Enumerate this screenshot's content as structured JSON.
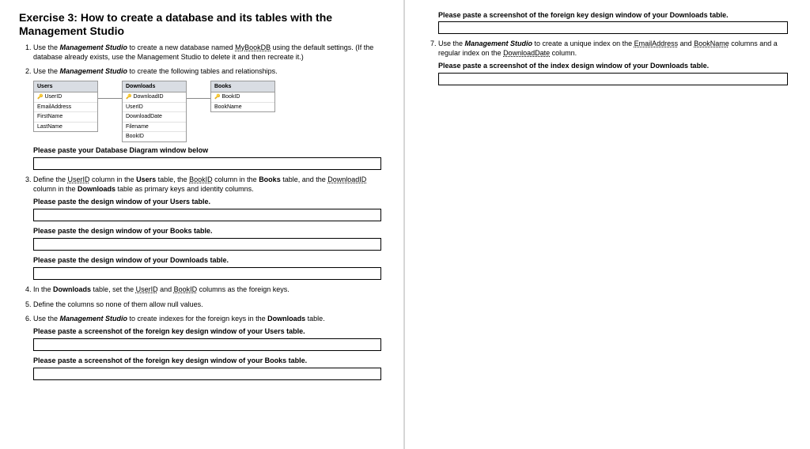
{
  "title": "Exercise 3: How to create a database and its tables with the Management Studio",
  "left": {
    "step1": {
      "pre": "Use the ",
      "tool": "Management Studio",
      "mid": " to create a new database named ",
      "db": "MyBookDB",
      "post": " using the default settings. (If the database already exists, use the Management Studio to delete it and then recreate it.)"
    },
    "step2": {
      "pre": "Use the ",
      "tool": "Management Studio",
      "post": " to create the following tables and relationships."
    },
    "diagram": {
      "users": {
        "title": "Users",
        "rows": [
          "UserID",
          "EmailAddress",
          "FirstName",
          "LastName"
        ]
      },
      "downloads": {
        "title": "Downloads",
        "rows": [
          "DownloadID",
          "UserID",
          "DownloadDate",
          "Filename",
          "BookID"
        ]
      },
      "books": {
        "title": "Books",
        "rows": [
          "BookID",
          "BookName"
        ]
      }
    },
    "diagPrompt": "Please paste your Database Diagram window below",
    "step3": {
      "p1": "Define the ",
      "c1": "UserID",
      "p2": " column in the ",
      "t1": "Users",
      "p3": " table, the ",
      "c2": "BookID",
      "p4": " column in the ",
      "t2": "Books",
      "p5": " table, and the ",
      "c3": "DownloadID",
      "p6": " column in the ",
      "t3": "Downloads",
      "p7": " table as primary keys and identity columns."
    },
    "prompt3a": "Please paste the design window of your Users table.",
    "prompt3b": "Please paste the design window of your Books table.",
    "prompt3c": "Please paste the design window of your Downloads table.",
    "step4": {
      "p1": "In the ",
      "t": "Downloads",
      "p2": " table, set the ",
      "c1": "UserID",
      "p3": " and ",
      "c2": "BookID",
      "p4": " columns as the foreign keys."
    },
    "step5": "Define the columns so none of them allow null values.",
    "step6": {
      "p1": "Use the ",
      "tool": "Management Studio",
      "p2": " to create indexes for the foreign keys in the ",
      "t": "Downloads",
      "p3": " table."
    },
    "prompt6a": "Please paste a screenshot of the foreign key design window of your Users table.",
    "prompt6b": "Please paste a screenshot of the foreign key design window of your Books table."
  },
  "right": {
    "promptTop": "Please paste a screenshot of the foreign key design window of your Downloads table.",
    "step7": {
      "p1": "Use the ",
      "tool": "Management Studio",
      "p2": " to create a unique index on the ",
      "c1": "EmailAddress",
      "p3": " and ",
      "c2": "BookName",
      "p4": " columns and a regular index on the ",
      "c3": "DownloadDate",
      "p5": " column."
    },
    "prompt7": "Please paste a screenshot of the index design window of your Downloads table."
  }
}
